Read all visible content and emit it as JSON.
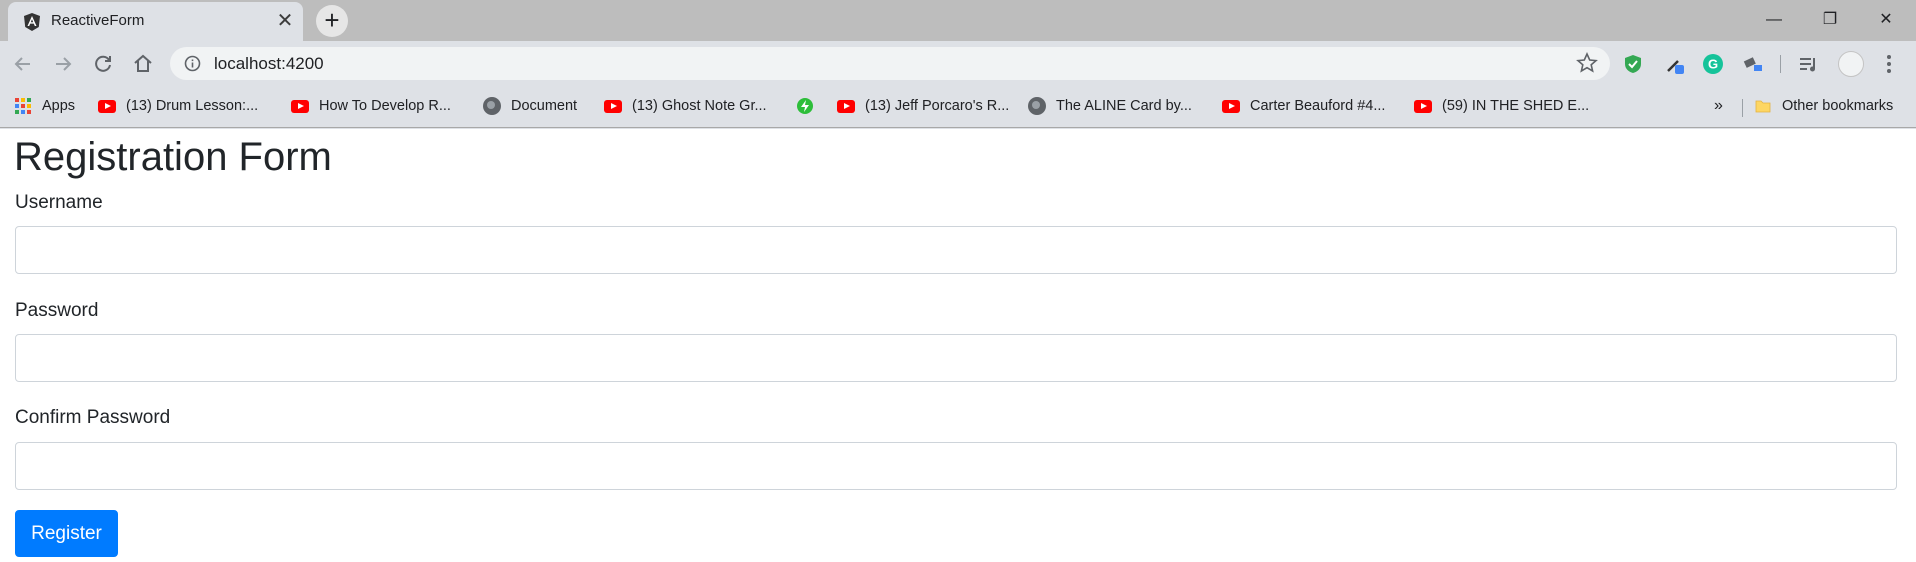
{
  "browser": {
    "tab": {
      "title": "ReactiveForm"
    },
    "omnibox": {
      "url": "localhost:4200"
    },
    "bookmarks": [
      {
        "label": "Apps",
        "icon": "apps-grid-icon"
      },
      {
        "label": "(13) Drum Lesson:...",
        "icon": "youtube-icon"
      },
      {
        "label": "How To Develop R...",
        "icon": "youtube-icon"
      },
      {
        "label": "Document",
        "icon": "globe-icon"
      },
      {
        "label": "(13) Ghost Note Gr...",
        "icon": "youtube-icon"
      },
      {
        "label": "",
        "icon": "green-bolt-icon"
      },
      {
        "label": "(13) Jeff Porcaro's R...",
        "icon": "youtube-icon"
      },
      {
        "label": "The ALINE Card by...",
        "icon": "globe-icon"
      },
      {
        "label": "Carter Beauford #4...",
        "icon": "youtube-icon"
      },
      {
        "label": "(59) IN THE SHED E...",
        "icon": "youtube-icon"
      }
    ],
    "overflow": "»",
    "other_bookmarks": "Other bookmarks"
  },
  "form": {
    "title": "Registration Form",
    "username_label": "Username",
    "password_label": "Password",
    "confirm_label": "Confirm Password",
    "username_value": "",
    "password_value": "",
    "confirm_value": "",
    "submit_label": "Register"
  },
  "colors": {
    "primary": "#007bff",
    "text": "#212529",
    "border": "#ced4da"
  }
}
